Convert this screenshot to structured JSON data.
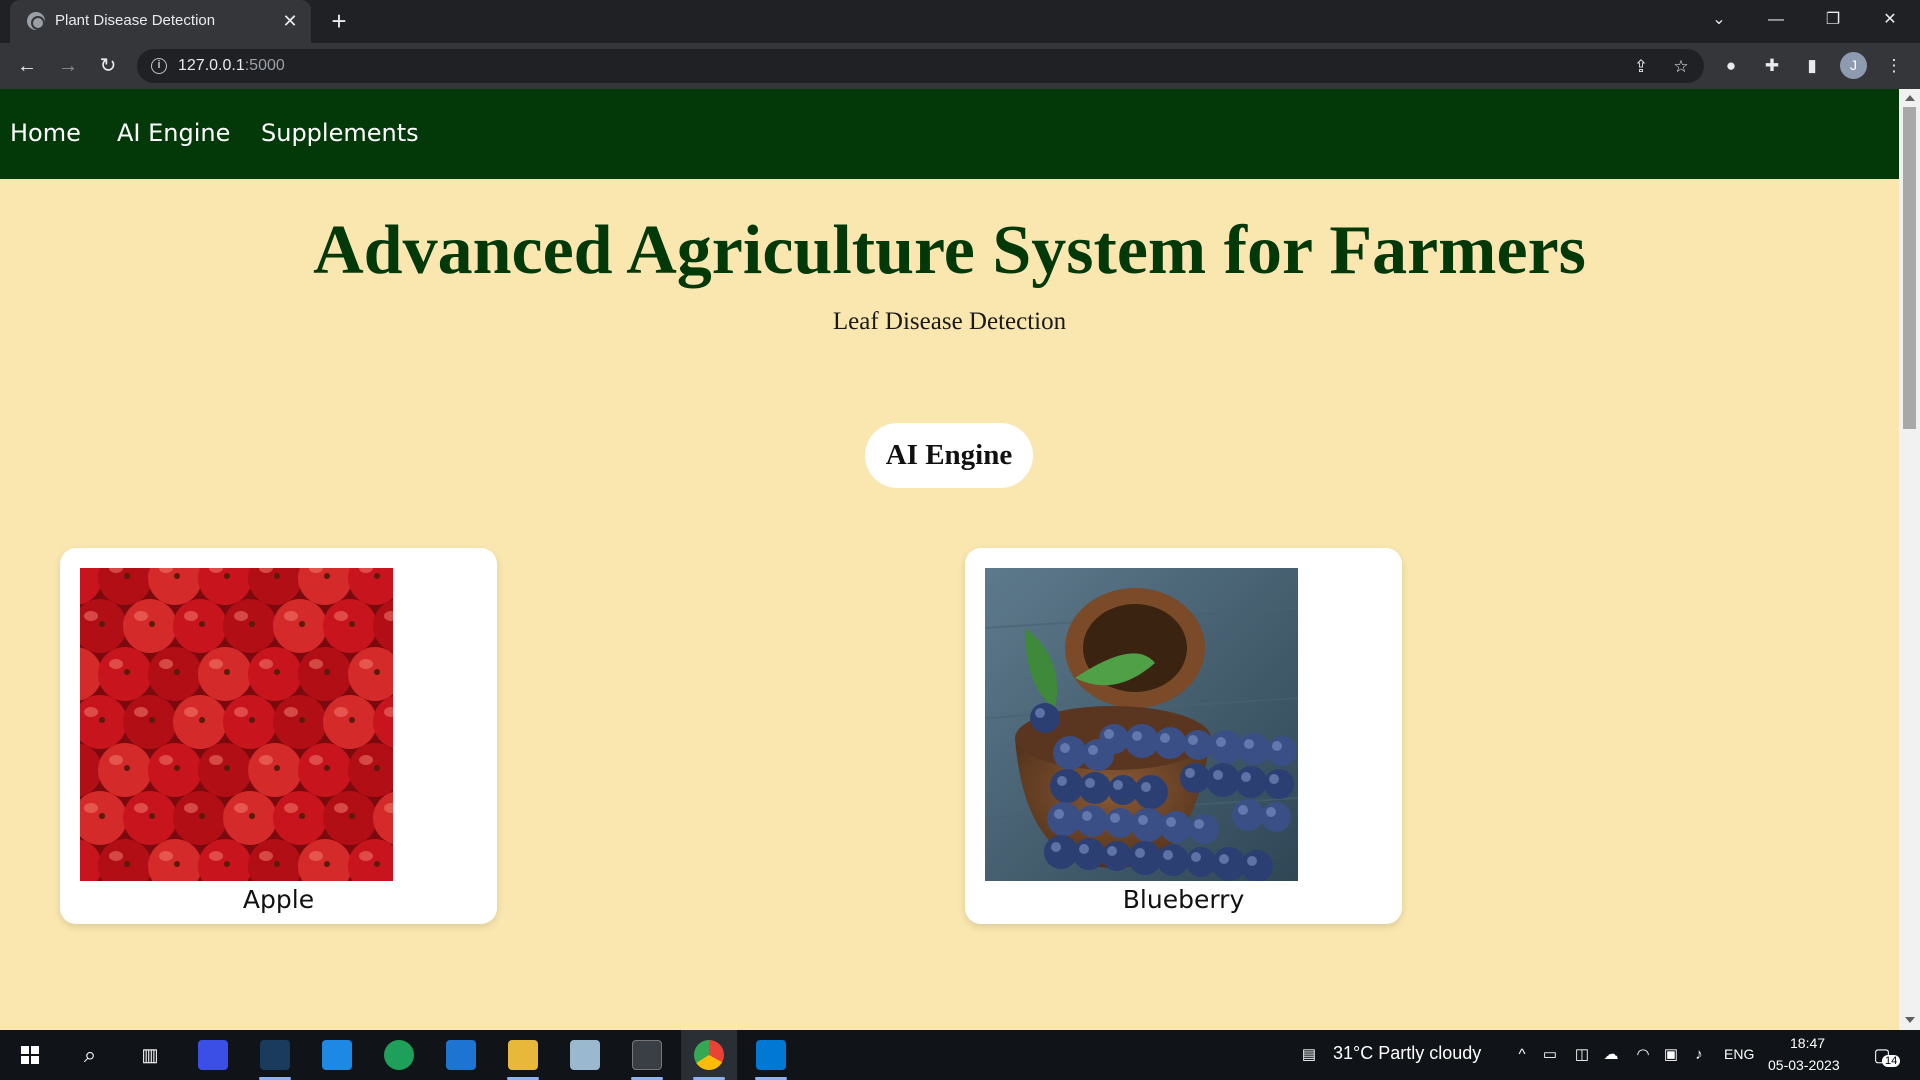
{
  "browser": {
    "tab_title": "Plant Disease Detection",
    "url_host": "127.0.0.1",
    "url_port": ":5000",
    "profile_initial": "J"
  },
  "nav": {
    "items": [
      {
        "label": "Home"
      },
      {
        "label": "AI Engine"
      },
      {
        "label": "Supplements"
      }
    ]
  },
  "hero": {
    "title": "Advanced Agriculture System for Farmers",
    "subtitle": "Leaf Disease Detection"
  },
  "engine_button": "AI Engine",
  "cards": [
    {
      "label": "Apple",
      "image": "red-apples-photo"
    },
    {
      "label": "Blueberry",
      "image": "blueberries-bowl-photo"
    }
  ],
  "taskbar": {
    "weather": "31°C  Partly cloudy",
    "language": "ENG",
    "time": "18:47",
    "date": "05-03-2023",
    "notifications": "14"
  },
  "colors": {
    "navbar": "#033809",
    "page_bg": "#fae7b0",
    "title": "#033809"
  }
}
